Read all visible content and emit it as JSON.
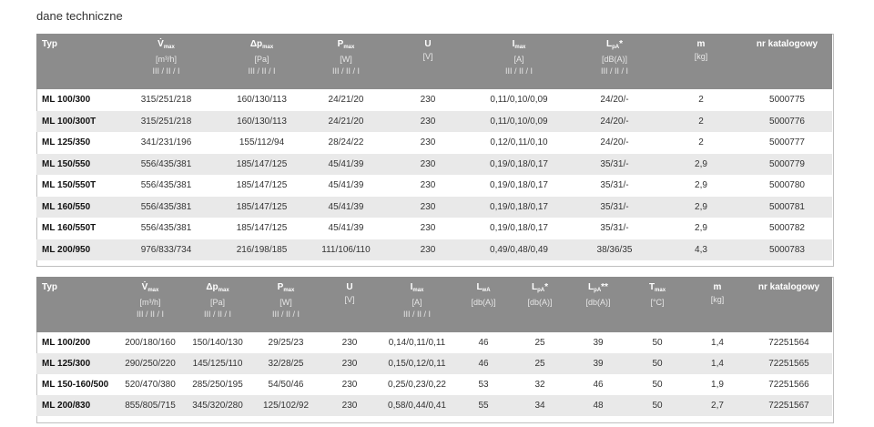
{
  "section_title": "dane techniczne",
  "table1": {
    "headers": [
      {
        "main": "Typ",
        "unit": "",
        "mode": ""
      },
      {
        "main": "V̇",
        "sub": "max",
        "unit": "[m³/h]",
        "mode": "III / II / I"
      },
      {
        "main": "Δp",
        "sub": "max",
        "unit": "[Pa]",
        "mode": "III / II / I"
      },
      {
        "main": "P",
        "sub": "max",
        "unit": "[W]",
        "mode": "III / II / I"
      },
      {
        "main": "U",
        "sub": "",
        "unit": "[V]",
        "mode": ""
      },
      {
        "main": "I",
        "sub": "max",
        "unit": "[A]",
        "mode": "III / II / I"
      },
      {
        "main": "L",
        "sub": "pA",
        "suffix": "*",
        "unit": "[dB(A)]",
        "mode": "III / II / I"
      },
      {
        "main": "m",
        "sub": "",
        "unit": "[kg]",
        "mode": ""
      },
      {
        "main": "nr katalogowy",
        "sub": "",
        "unit": "",
        "mode": ""
      }
    ],
    "rows": [
      [
        "ML 100/300",
        "315/251/218",
        "160/130/113",
        "24/21/20",
        "230",
        "0,11/0,10/0,09",
        "24/20/-",
        "2",
        "5000775"
      ],
      [
        "ML 100/300T",
        "315/251/218",
        "160/130/113",
        "24/21/20",
        "230",
        "0,11/0,10/0,09",
        "24/20/-",
        "2",
        "5000776"
      ],
      [
        "ML 125/350",
        "341/231/196",
        "155/112/94",
        "28/24/22",
        "230",
        "0,12/0,11/0,10",
        "24/20/-",
        "2",
        "5000777"
      ],
      [
        "ML 150/550",
        "556/435/381",
        "185/147/125",
        "45/41/39",
        "230",
        "0,19/0,18/0,17",
        "35/31/-",
        "2,9",
        "5000779"
      ],
      [
        "ML 150/550T",
        "556/435/381",
        "185/147/125",
        "45/41/39",
        "230",
        "0,19/0,18/0,17",
        "35/31/-",
        "2,9",
        "5000780"
      ],
      [
        "ML 160/550",
        "556/435/381",
        "185/147/125",
        "45/41/39",
        "230",
        "0,19/0,18/0,17",
        "35/31/-",
        "2,9",
        "5000781"
      ],
      [
        "ML 160/550T",
        "556/435/381",
        "185/147/125",
        "45/41/39",
        "230",
        "0,19/0,18/0,17",
        "35/31/-",
        "2,9",
        "5000782"
      ],
      [
        "ML 200/950",
        "976/833/734",
        "216/198/185",
        "111/106/110",
        "230",
        "0,49/0,48/0,49",
        "38/36/35",
        "4,3",
        "5000783"
      ]
    ]
  },
  "table2": {
    "headers": [
      {
        "main": "Typ",
        "unit": "",
        "mode": ""
      },
      {
        "main": "V̇",
        "sub": "max",
        "unit": "[m³/h]",
        "mode": "III / II / I"
      },
      {
        "main": "Δp",
        "sub": "max",
        "unit": "[Pa]",
        "mode": "III / II / I"
      },
      {
        "main": "P",
        "sub": "max",
        "unit": "[W]",
        "mode": "III / II / I"
      },
      {
        "main": "U",
        "sub": "",
        "unit": "[V]",
        "mode": ""
      },
      {
        "main": "I",
        "sub": "max",
        "unit": "[A]",
        "mode": "III / II / I"
      },
      {
        "main": "L",
        "sub": "wA",
        "unit": "[db(A)]",
        "mode": ""
      },
      {
        "main": "L",
        "sub": "pA",
        "suffix": "*",
        "unit": "[db(A)]",
        "mode": ""
      },
      {
        "main": "L",
        "sub": "pA",
        "suffix": "**",
        "unit": "[db(A)]",
        "mode": ""
      },
      {
        "main": "T",
        "sub": "max",
        "unit": "[°C]",
        "mode": ""
      },
      {
        "main": "m",
        "sub": "",
        "unit": "[kg]",
        "mode": ""
      },
      {
        "main": "nr katalogowy",
        "sub": "",
        "unit": "",
        "mode": ""
      }
    ],
    "rows": [
      [
        "ML 100/200",
        "200/180/160",
        "150/140/130",
        "29/25/23",
        "230",
        "0,14/0,11/0,11",
        "46",
        "25",
        "39",
        "50",
        "1,4",
        "72251564"
      ],
      [
        "ML 125/300",
        "290/250/220",
        "145/125/110",
        "32/28/25",
        "230",
        "0,15/0,12/0,11",
        "46",
        "25",
        "39",
        "50",
        "1,4",
        "72251565"
      ],
      [
        "ML 150-160/500",
        "520/470/380",
        "285/250/195",
        "54/50/46",
        "230",
        "0,25/0,23/0,22",
        "53",
        "32",
        "46",
        "50",
        "1,9",
        "72251566"
      ],
      [
        "ML 200/830",
        "855/805/715",
        "345/320/280",
        "125/102/92",
        "230",
        "0,58/0,44/0,41",
        "55",
        "34",
        "48",
        "50",
        "2,7",
        "72251567"
      ]
    ]
  }
}
